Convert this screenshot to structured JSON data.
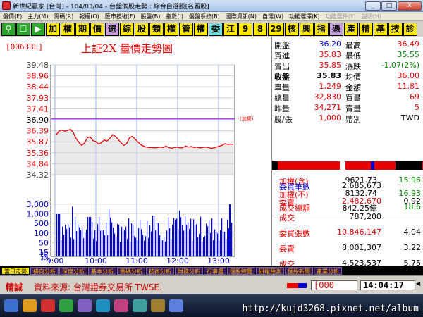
{
  "window": {
    "title": "新世紀贏家 [台灣] - 104/03/04 - 台盤個股走勢 : 綜合自選股[名留股]",
    "buttons": [
      "_",
      "□",
      "X"
    ]
  },
  "menu": [
    "盤價(E)",
    "主力(M)",
    "籌碼(R)",
    "報權(O)",
    "匯市技術(F)",
    "股盤(B)",
    "指數(I)",
    "盤盤系統(B)",
    "國際資訊(N)",
    "自選(W)",
    "功能選擇(K)",
    "功能選件(Y)",
    "說明(H)"
  ],
  "toolbar": [
    {
      "label": "⚲",
      "kind": "icon",
      "name": "search-icon"
    },
    {
      "label": "☐",
      "kind": "icon",
      "name": "window-icon"
    },
    {
      "label": "▶",
      "kind": "icon",
      "name": "play-icon"
    },
    {
      "label": "加",
      "kind": "yellow"
    },
    {
      "label": "權",
      "kind": "yellow"
    },
    {
      "label": "期",
      "kind": "yellow"
    },
    {
      "label": "價",
      "kind": "yellow"
    },
    {
      "label": "選",
      "kind": "purple"
    },
    {
      "label": "綜",
      "kind": "yellow"
    },
    {
      "label": "股",
      "kind": "yellow"
    },
    {
      "label": "類",
      "kind": "yellow"
    },
    {
      "label": "權",
      "kind": "yellow"
    },
    {
      "label": "管",
      "kind": "yellow"
    },
    {
      "label": "權",
      "kind": "yellow"
    },
    {
      "label": "委",
      "kind": "cyan"
    },
    {
      "label": "江",
      "kind": "yellow"
    },
    {
      "label": "9",
      "kind": "num"
    },
    {
      "label": "8",
      "kind": "num"
    },
    {
      "label": "29",
      "kind": "num"
    },
    {
      "label": "核",
      "kind": "yellow"
    },
    {
      "label": "興",
      "kind": "yellow"
    },
    {
      "label": "指",
      "kind": "yellow"
    },
    {
      "label": "憑",
      "kind": "purple"
    },
    {
      "label": "產",
      "kind": "yellow"
    },
    {
      "label": "精",
      "kind": "yellow"
    },
    {
      "label": "基",
      "kind": "yellow"
    },
    {
      "label": "技",
      "kind": "yellow"
    },
    {
      "label": "診",
      "kind": "yellow"
    }
  ],
  "chart_panel": {
    "code": "[00633L]",
    "title": "上証2X 量價走勢圖",
    "volume_unit": "張",
    "ref_label": "(加權)"
  },
  "chart_data": {
    "type": "line",
    "price_ticks": [
      "39.48",
      "38.96",
      "38.44",
      "37.93",
      "37.41",
      "36.90",
      "36.39",
      "35.87",
      "35.36",
      "34.84",
      "34.32"
    ],
    "volume_ticks": [
      "3,000",
      "1,000",
      "500",
      "100",
      "50",
      "15"
    ],
    "x_ticks": [
      "9:00",
      "10:00",
      "11:00",
      "12:00",
      "13:00"
    ],
    "ylim": [
      34.32,
      39.48
    ],
    "reference_price": 36.9,
    "price_series": [
      36.2,
      36.38,
      36.42,
      36.36,
      36.4,
      36.45,
      36.3,
      36.02,
      35.84,
      35.7,
      35.8,
      36.05,
      36.1,
      35.92,
      35.88,
      35.76,
      35.82,
      35.95,
      35.9,
      36.02,
      36.2,
      36.12,
      35.98,
      35.82,
      35.7,
      35.78,
      36.05,
      36.12,
      36.0,
      35.86,
      35.74,
      35.66,
      35.62,
      35.6,
      35.6,
      35.58,
      35.6,
      35.62,
      35.6,
      35.66,
      35.6,
      35.56,
      35.6,
      35.62,
      35.58,
      35.6,
      35.66,
      35.62,
      35.64,
      35.6,
      35.62,
      35.58,
      35.6,
      35.62,
      35.6,
      35.56,
      35.58,
      35.62,
      35.66,
      35.7,
      35.78,
      35.74,
      35.76,
      35.75
    ]
  },
  "quote": {
    "rows": [
      {
        "l1": "開盤",
        "v1": "36.20",
        "l2": "最高",
        "v2": "36.49"
      },
      {
        "l1": "買進",
        "v1": "35.83",
        "l2": "最低",
        "v2": "35.55"
      },
      {
        "l1": "賣出",
        "v1": "35.85",
        "l2": "漲跌",
        "v2": "-1.07(2%)"
      },
      {
        "l1": "收盤",
        "v1": "35.83",
        "l2": "均價",
        "v2": "36.00"
      },
      {
        "l1": "單量",
        "v1": "1,249",
        "l2": "金額",
        "v2": "11.81"
      },
      {
        "l1": "總量",
        "v1": "32,830",
        "l2": "買量",
        "v2": "69"
      },
      {
        "l1": "昨量",
        "v1": "34,271",
        "l2": "賣量",
        "v2": "5"
      },
      {
        "l1": "股/張",
        "v1": "1,000",
        "l2": "幣別",
        "v2": "TWD"
      }
    ],
    "index_rows": [
      {
        "label": "加權(含)",
        "value": "9621.73",
        "change": "15.96"
      },
      {
        "label": "加權(不)",
        "value": "8132.74",
        "change": "16.93"
      },
      {
        "label": "成交總額",
        "value": "842.25億",
        "change": "18.6"
      }
    ],
    "stat_rows": [
      {
        "label": "委買筆數",
        "value": "2,685,673",
        "extra": ""
      },
      {
        "label": "委賣",
        "value": "2,482,670",
        "extra": "0.92"
      },
      {
        "label": "成交",
        "value": "787,200",
        "extra": ""
      },
      {
        "label": "委買張數",
        "value": "10,846,147",
        "extra": "4.04"
      },
      {
        "label": "委賣",
        "value": "8,001,307",
        "extra": "3.22"
      },
      {
        "label": "成交",
        "value": "4,523,537",
        "extra": "5.75"
      }
    ]
  },
  "tabs": [
    "當日走勢",
    "橫向分析",
    "深度分析",
    "基本分析",
    "籌碼分析",
    "技術分析",
    "財務分析",
    "行事曆",
    "個股總覽",
    "研報預測",
    "個股新聞",
    "產業分析"
  ],
  "status": {
    "badge": "精誠",
    "source": "資料來源: 台灣證券交易所 TWSE.",
    "input_value": "[000",
    "time": "14:04:17"
  },
  "taskbar": {
    "watermark": "http://kujd3268.pixnet.net/album"
  },
  "colors": {
    "up": "#e00000",
    "down": "#008000",
    "neutral": "#0000cc",
    "toolbar_button": "#ffe800"
  }
}
